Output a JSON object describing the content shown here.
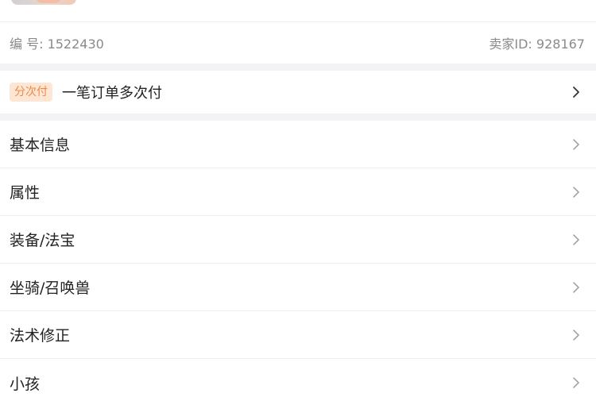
{
  "listing": {
    "id_label": "编 号: 1522430",
    "seller_label": "卖家ID: 928167"
  },
  "payment": {
    "badge": "分次付",
    "text": "一笔订单多次付",
    "icon": "chevron-right-icon"
  },
  "sections": [
    {
      "label": "基本信息",
      "icon": "chevron-right-icon"
    },
    {
      "label": "属性",
      "icon": "chevron-right-icon"
    },
    {
      "label": "装备/法宝",
      "icon": "chevron-right-icon"
    },
    {
      "label": "坐骑/召唤兽",
      "icon": "chevron-right-icon"
    },
    {
      "label": "法术修正",
      "icon": "chevron-right-icon"
    },
    {
      "label": "小孩",
      "icon": "chevron-right-icon"
    }
  ],
  "colors": {
    "badge_bg": "#fde6d4",
    "badge_text": "#ee8a45",
    "separator": "#f3f3f5",
    "muted_text": "#8a8a8a"
  }
}
